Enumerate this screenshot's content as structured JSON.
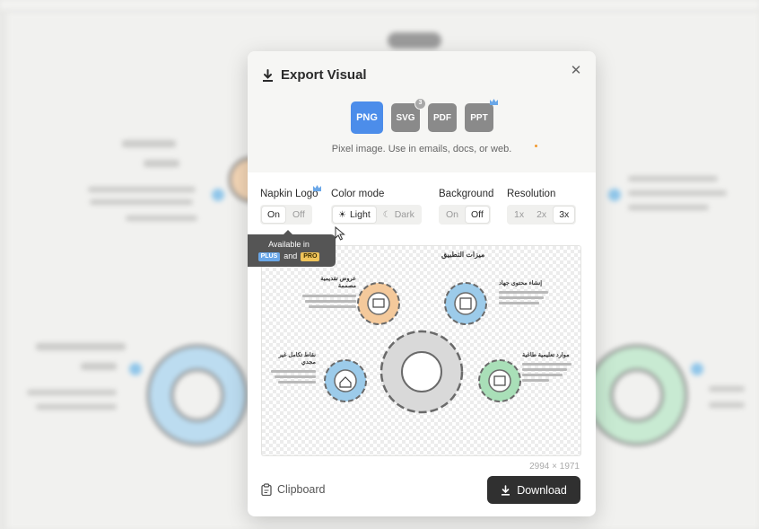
{
  "dialog": {
    "title": "Export Visual",
    "close_glyph": "✕"
  },
  "formats": {
    "items": [
      {
        "label": "PNG",
        "active": true
      },
      {
        "label": "SVG",
        "badge": "3"
      },
      {
        "label": "PDF"
      },
      {
        "label": "PPT"
      }
    ],
    "description": "Pixel image. Use in emails, docs, or web."
  },
  "options": {
    "napkin_logo": {
      "label": "Napkin Logo",
      "on": "On",
      "off": "Off",
      "selected": "On"
    },
    "color_mode": {
      "label": "Color mode",
      "light": "Light",
      "dark": "Dark",
      "selected": "Light"
    },
    "background": {
      "label": "Background",
      "on": "On",
      "off": "Off",
      "selected": "Off"
    },
    "resolution": {
      "label": "Resolution",
      "opt1": "1x",
      "opt2": "2x",
      "opt3": "3x",
      "selected": "3x"
    }
  },
  "tooltip": {
    "line1": "Available in",
    "plus": "PLUS",
    "and": "and",
    "pro": "PRO"
  },
  "preview": {
    "title": "ميزات التطبيق",
    "items": [
      {
        "heading": "عروض تقديمية مصممة"
      },
      {
        "heading": "إنشاء محتوى جهاد"
      },
      {
        "heading": "نقاط تكامل غير مجدي"
      },
      {
        "heading": "موارد تعليمية طاغية"
      }
    ],
    "dimensions": "2994 × 1971"
  },
  "footer": {
    "clipboard_label": "Clipboard",
    "download_label": "Download"
  },
  "colors": {
    "accent": "#4c8dea",
    "format_inactive": "#8a8a8a",
    "download_bg": "#303030",
    "gear_orange": "#f4c99b",
    "gear_blue": "#9ccbea",
    "gear_green": "#a9dfb8",
    "gear_grey": "#d9d9d9"
  }
}
